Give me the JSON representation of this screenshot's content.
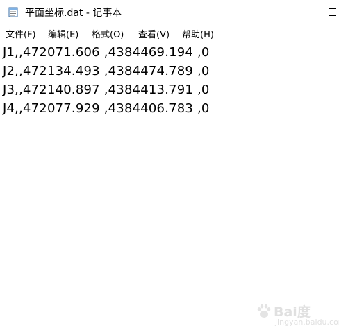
{
  "window": {
    "title": "平面坐标.dat - 记事本",
    "icon": "notepad-icon"
  },
  "menu": {
    "file": "文件(F)",
    "edit": "编辑(E)",
    "format": "格式(O)",
    "view": "查看(V)",
    "help": "帮助(H)"
  },
  "content": {
    "lines": [
      "J1,,472071.606 ,4384469.194 ,0",
      "J2,,472134.493 ,4384474.789 ,0",
      "J3,,472140.897 ,4384413.791 ,0",
      "J4,,472077.929 ,4384406.783 ,0"
    ]
  },
  "watermark": {
    "text": "Bai度",
    "sub": "jingyan.baidu.com"
  }
}
